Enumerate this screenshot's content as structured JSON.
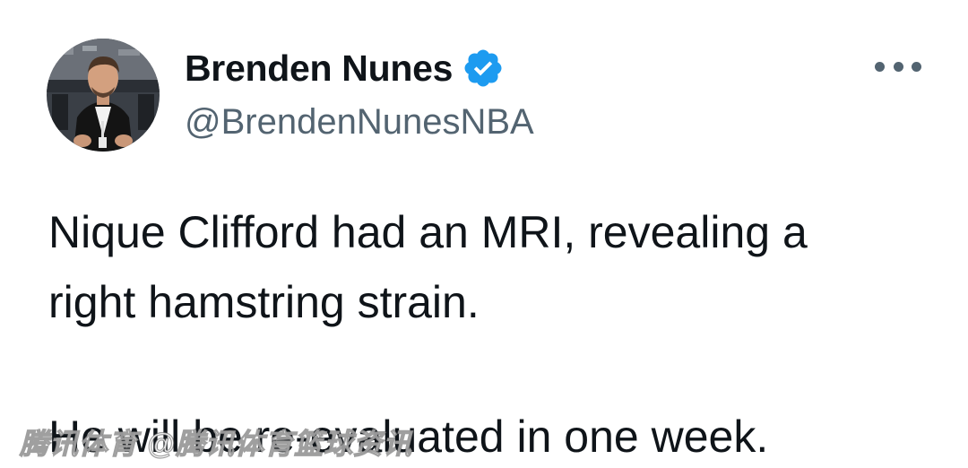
{
  "author": {
    "display_name": "Brenden Nunes",
    "handle": "@BrendenNunesNBA",
    "verified_icon": "verified-badge-icon",
    "avatar_icon": "profile-photo"
  },
  "menu": {
    "more_icon": "more-horizontal-icon"
  },
  "tweet": {
    "line1": "Nique Clifford had an MRI, revealing a",
    "line2": "right hamstring strain.",
    "line3": "He will be re-evaluated in one week."
  },
  "watermark": {
    "text": "腾讯体育 @腾讯体育篮球资讯"
  },
  "colors": {
    "text": "#0f1419",
    "secondary": "#536471",
    "verified": "#1d9bf0",
    "background": "#ffffff"
  }
}
